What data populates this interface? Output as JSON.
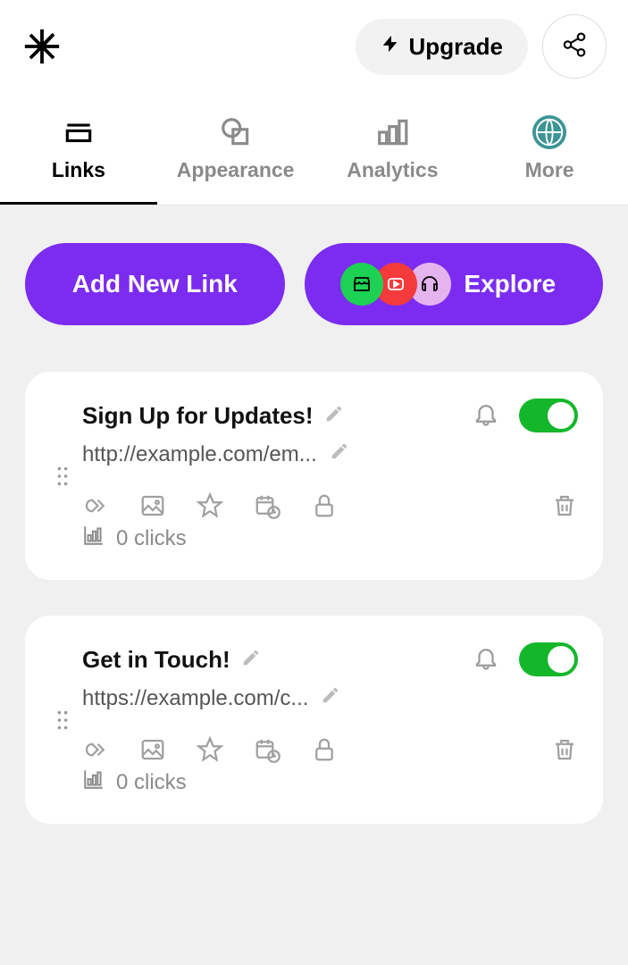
{
  "header": {
    "upgrade_label": "Upgrade"
  },
  "tabs": [
    {
      "label": "Links"
    },
    {
      "label": "Appearance"
    },
    {
      "label": "Analytics"
    },
    {
      "label": "More"
    }
  ],
  "buttons": {
    "add_new_link": "Add New Link",
    "explore": "Explore"
  },
  "links": [
    {
      "title": "Sign Up for Updates!",
      "url": "http://example.com/em...",
      "clicks": "0 clicks",
      "enabled": true
    },
    {
      "title": "Get in Touch!",
      "url": "https://example.com/c...",
      "clicks": "0 clicks",
      "enabled": true
    }
  ]
}
